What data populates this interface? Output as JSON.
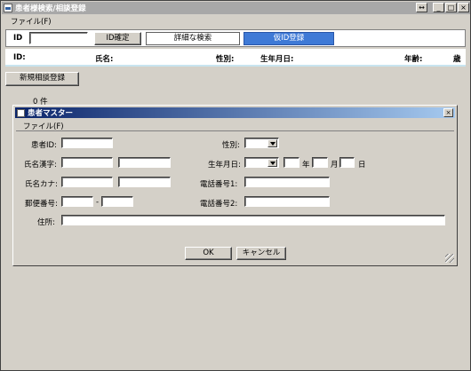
{
  "window": {
    "title": "患者様検索/相談登録",
    "minimize": "_",
    "maximize": "□",
    "close": "×",
    "restore_extra": "↔"
  },
  "menu": {
    "file": "ファイル(F)"
  },
  "search": {
    "id_label": "ID",
    "id_value": "",
    "confirm_button": "ID確定",
    "detail_button": "詳細な検索",
    "temp_button": "仮ID登録"
  },
  "info": {
    "id_label": "ID:",
    "name_label": "氏名:",
    "gender_label": "性別:",
    "birth_label": "生年月日:",
    "age_label": "年齢:",
    "age_unit": "歳"
  },
  "new_consult_button": "新規相談登録",
  "count": "0 件",
  "dialog": {
    "title": "患者マスター",
    "close": "×",
    "menu_file": "ファイル(F)",
    "patient_id_label": "患者ID:",
    "gender_label": "性別:",
    "name_kanji_label": "氏名漢字:",
    "birth_label": "生年月日:",
    "year_unit": "年",
    "month_unit": "月",
    "day_unit": "日",
    "name_kana_label": "氏名カナ:",
    "phone1_label": "電話番号1:",
    "postal_label": "郵便番号:",
    "postal_sep": "-",
    "phone2_label": "電話番号2:",
    "address_label": "住所:",
    "ok_button": "OK",
    "cancel_button": "キャンセル"
  }
}
